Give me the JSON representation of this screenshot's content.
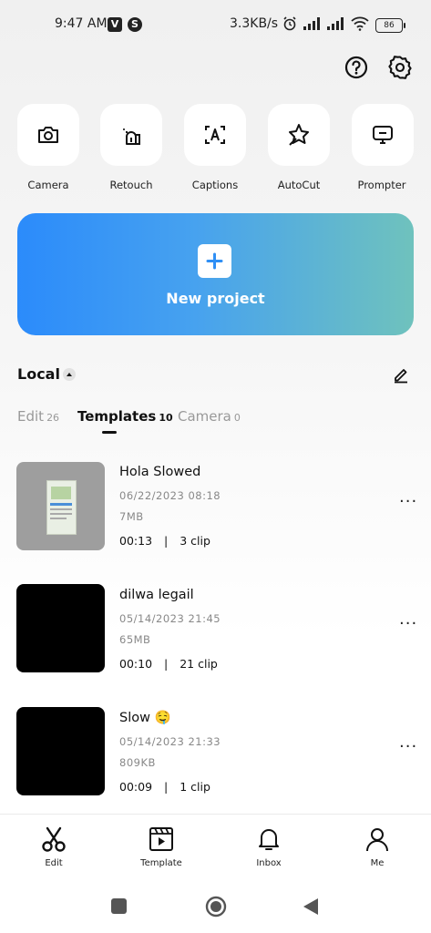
{
  "status_bar": {
    "time": "9:47 AM",
    "speed": "3.3KB/s",
    "battery": "86"
  },
  "header": {
    "help_icon": "question-circle-icon",
    "settings_icon": "gear-icon"
  },
  "tools": [
    {
      "label": "Camera",
      "icon": "camera-icon"
    },
    {
      "label": "Retouch",
      "icon": "retouch-icon"
    },
    {
      "label": "Captions",
      "icon": "captions-icon"
    },
    {
      "label": "AutoCut",
      "icon": "autocut-icon"
    },
    {
      "label": "Prompter",
      "icon": "prompter-icon"
    }
  ],
  "new_project": {
    "label": "New project",
    "gradient_start": "#2b8bfb",
    "gradient_end": "#6fc2bd"
  },
  "local": {
    "title": "Local"
  },
  "tabs": [
    {
      "label": "Edit",
      "count": "26"
    },
    {
      "label": "Templates",
      "count": "10",
      "active": true
    },
    {
      "label": "Camera",
      "count": "0"
    }
  ],
  "items": [
    {
      "title": "Hola Slowed",
      "date": "06/22/2023 08:18",
      "size": "7MB",
      "duration": "00:13",
      "clips": "3 clip"
    },
    {
      "title": "dilwa legail",
      "date": "05/14/2023 21:45",
      "size": "65MB",
      "duration": "00:10",
      "clips": "21 clip"
    },
    {
      "title": "Slow 🤤",
      "date": "05/14/2023 21:33",
      "size": "809KB",
      "duration": "00:09",
      "clips": "1 clip"
    }
  ],
  "more_label": "···",
  "separator": "|",
  "bottom_nav": [
    {
      "label": "Edit",
      "icon": "scissors-icon"
    },
    {
      "label": "Template",
      "icon": "template-icon"
    },
    {
      "label": "Inbox",
      "icon": "bell-icon"
    },
    {
      "label": "Me",
      "icon": "person-icon"
    }
  ],
  "system_nav": [
    "square-icon",
    "home-circle-icon",
    "back-triangle-icon"
  ]
}
